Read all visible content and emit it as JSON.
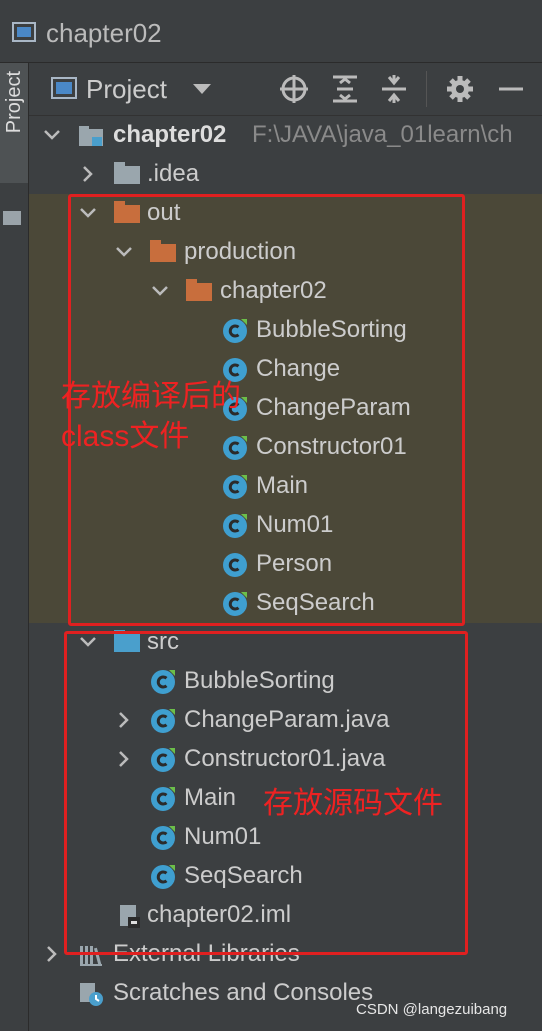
{
  "window": {
    "title": "chapter02"
  },
  "sidebar": {
    "tab_label": "Project"
  },
  "toolbar": {
    "view_label": "Project",
    "icons": [
      "crosshair-icon",
      "expand-all-icon",
      "collapse-all-icon",
      "gear-icon",
      "minimize-icon"
    ]
  },
  "tree": {
    "root": {
      "label": "chapter02",
      "path": "F:\\JAVA\\java_01learn\\ch"
    },
    "idea": {
      "label": ".idea"
    },
    "out": {
      "label": "out"
    },
    "production": {
      "label": "production"
    },
    "out_chapter02": {
      "label": "chapter02"
    },
    "compiled_classes": [
      "BubbleSorting",
      "Change",
      "ChangeParam",
      "Constructor01",
      "Main",
      "Num01",
      "Person",
      "SeqSearch"
    ],
    "src": {
      "label": "src"
    },
    "src_items": [
      "BubbleSorting",
      "ChangeParam.java",
      "Constructor01.java",
      "Main",
      "Num01",
      "SeqSearch"
    ],
    "iml": {
      "label": "chapter02.iml"
    },
    "external_libraries": {
      "label": "External Libraries"
    },
    "scratches": {
      "label": "Scratches and Consoles"
    }
  },
  "annotations": {
    "out_note_line1": "存放编译后的",
    "out_note_line2": "class文件",
    "src_note": "存放源码文件"
  },
  "watermark": "CSDN @langezuibang",
  "colors": {
    "background": "#3c3f41",
    "highlight_row": "#4b4838",
    "annotation_red": "#e02020",
    "class_icon": "#3f9fd0",
    "folder_out": "#c86e3d",
    "folder_src": "#4a9fcc"
  }
}
